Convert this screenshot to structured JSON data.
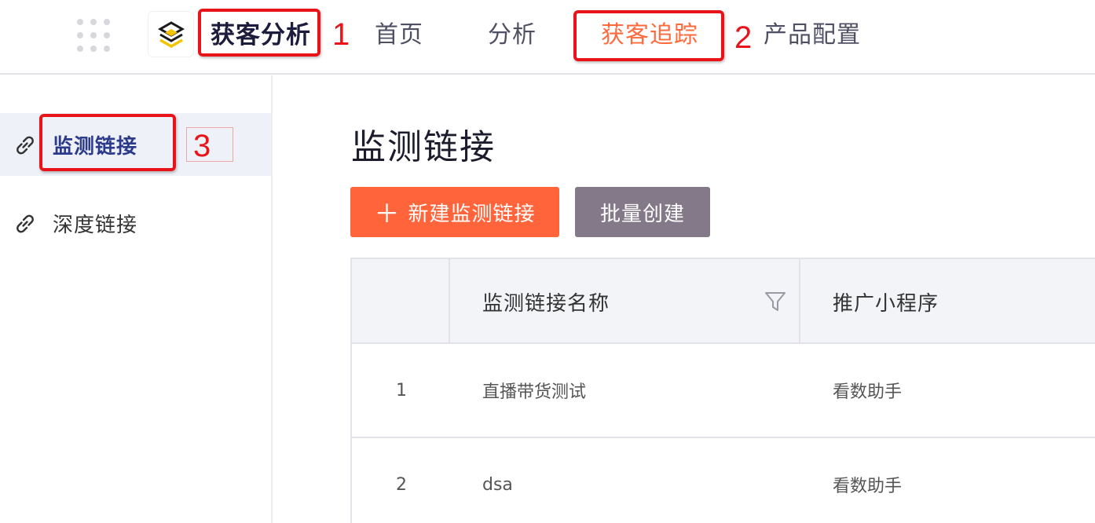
{
  "topbar": {
    "brand": "获客分析",
    "nav": [
      {
        "label": "首页"
      },
      {
        "label": "分析"
      },
      {
        "label": "获客追踪",
        "active": true
      },
      {
        "label": "产品配置"
      }
    ],
    "active_color": "#ff6a3d"
  },
  "annotations": [
    "1",
    "2",
    "3"
  ],
  "sidebar": {
    "items": [
      {
        "label": "监测链接",
        "icon": "link-icon",
        "active": true
      },
      {
        "label": "深度链接",
        "icon": "link-icon",
        "active": false
      }
    ]
  },
  "main": {
    "title": "监测链接",
    "buttons": {
      "create": "新建监测链接",
      "create_icon": "plus-icon",
      "batch": "批量创建"
    },
    "table": {
      "columns": [
        "",
        "监测链接名称",
        "推广小程序"
      ],
      "filter_icon": "filter-icon",
      "rows": [
        {
          "index": "1",
          "name": "直播带货测试",
          "miniprogram": "看数助手"
        },
        {
          "index": "2",
          "name": "dsa",
          "miniprogram": "看数助手"
        }
      ]
    }
  },
  "colors": {
    "primary_button": "#ff643a",
    "secondary_button": "#847988",
    "annotation": "#e8141a"
  }
}
